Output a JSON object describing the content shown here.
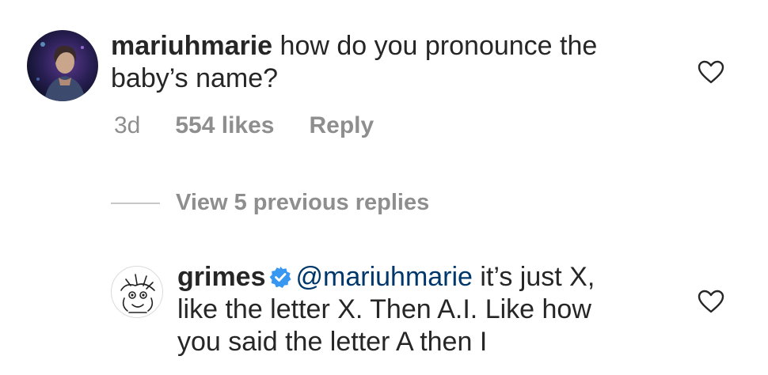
{
  "comment": {
    "username": "mariuhmarie",
    "text_line1": "how do you pronounce the",
    "text_line2": "baby’s name?",
    "age": "3d",
    "likes": "554 likes",
    "reply_label": "Reply",
    "liked": false
  },
  "view_replies": {
    "label": "View 5 previous replies"
  },
  "reply": {
    "username": "grimes",
    "verified": true,
    "mention": "@mariuhmarie",
    "text_line1": "it’s just X,",
    "text_line2": "like the letter X.  Then A.I. Like how",
    "text_line3": "you said the letter A then I",
    "liked": false
  },
  "colors": {
    "text": "#262626",
    "muted": "#8e8e8e",
    "mention": "#00376b",
    "verified": "#3897f0"
  },
  "icons": {
    "like": "heart-outline-icon",
    "verified": "verified-badge-icon"
  }
}
